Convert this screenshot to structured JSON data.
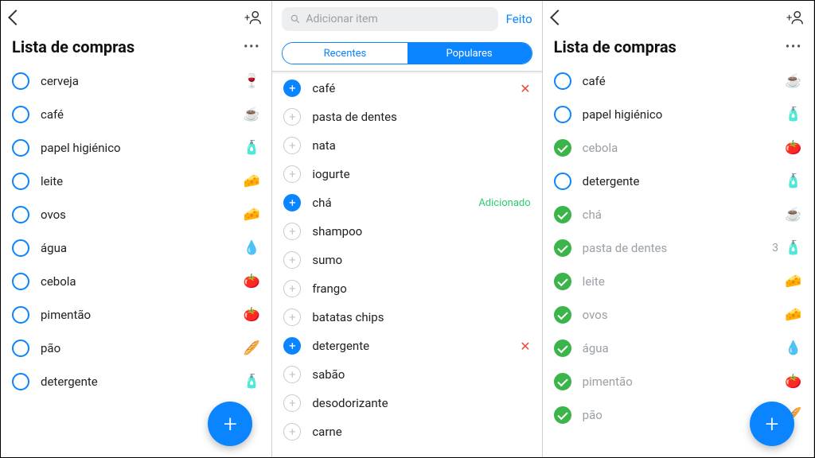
{
  "pane1": {
    "title": "Lista de compras",
    "items": [
      {
        "label": "cerveja",
        "icon": "🍷",
        "checked": false
      },
      {
        "label": "café",
        "icon": "☕",
        "checked": false
      },
      {
        "label": "papel higiénico",
        "icon": "🧴",
        "checked": false
      },
      {
        "label": "leite",
        "icon": "🧀",
        "checked": false
      },
      {
        "label": "ovos",
        "icon": "🧀",
        "checked": false
      },
      {
        "label": "água",
        "icon": "💧",
        "checked": false
      },
      {
        "label": "cebola",
        "icon": "🍅",
        "checked": false
      },
      {
        "label": "pimentão",
        "icon": "🍅",
        "checked": false
      },
      {
        "label": "pão",
        "icon": "🥖",
        "checked": false
      },
      {
        "label": "detergente",
        "icon": "🧴",
        "checked": false
      }
    ]
  },
  "pane2": {
    "search_placeholder": "Adicionar item",
    "done": "Feito",
    "seg_recent": "Recentes",
    "seg_popular": "Populares",
    "added_label": "Adicionado",
    "suggestions": [
      {
        "label": "café",
        "state": "selected_x"
      },
      {
        "label": "pasta de dentes",
        "state": "none"
      },
      {
        "label": "nata",
        "state": "none"
      },
      {
        "label": "iogurte",
        "state": "none"
      },
      {
        "label": "chá",
        "state": "added"
      },
      {
        "label": "shampoo",
        "state": "none"
      },
      {
        "label": "sumo",
        "state": "none"
      },
      {
        "label": "frango",
        "state": "none"
      },
      {
        "label": "batatas chips",
        "state": "none"
      },
      {
        "label": "detergente",
        "state": "selected_x"
      },
      {
        "label": "sabão",
        "state": "none"
      },
      {
        "label": "desodorizante",
        "state": "none"
      },
      {
        "label": "carne",
        "state": "none"
      }
    ]
  },
  "pane3": {
    "title": "Lista de compras",
    "items": [
      {
        "label": "café",
        "icon": "☕",
        "checked": false,
        "qty": ""
      },
      {
        "label": "papel higiénico",
        "icon": "🧴",
        "checked": false,
        "qty": ""
      },
      {
        "label": "cebola",
        "icon": "🍅",
        "checked": true,
        "qty": ""
      },
      {
        "label": "detergente",
        "icon": "🧴",
        "checked": false,
        "qty": ""
      },
      {
        "label": "chá",
        "icon": "☕",
        "checked": true,
        "qty": ""
      },
      {
        "label": "pasta de dentes",
        "icon": "🧴",
        "checked": true,
        "qty": "3"
      },
      {
        "label": "leite",
        "icon": "🧀",
        "checked": true,
        "qty": ""
      },
      {
        "label": "ovos",
        "icon": "🧀",
        "checked": true,
        "qty": ""
      },
      {
        "label": "água",
        "icon": "💧",
        "checked": true,
        "qty": ""
      },
      {
        "label": "pimentão",
        "icon": "🍅",
        "checked": true,
        "qty": ""
      },
      {
        "label": "pão",
        "icon": "🥖",
        "checked": true,
        "qty": ""
      }
    ]
  }
}
